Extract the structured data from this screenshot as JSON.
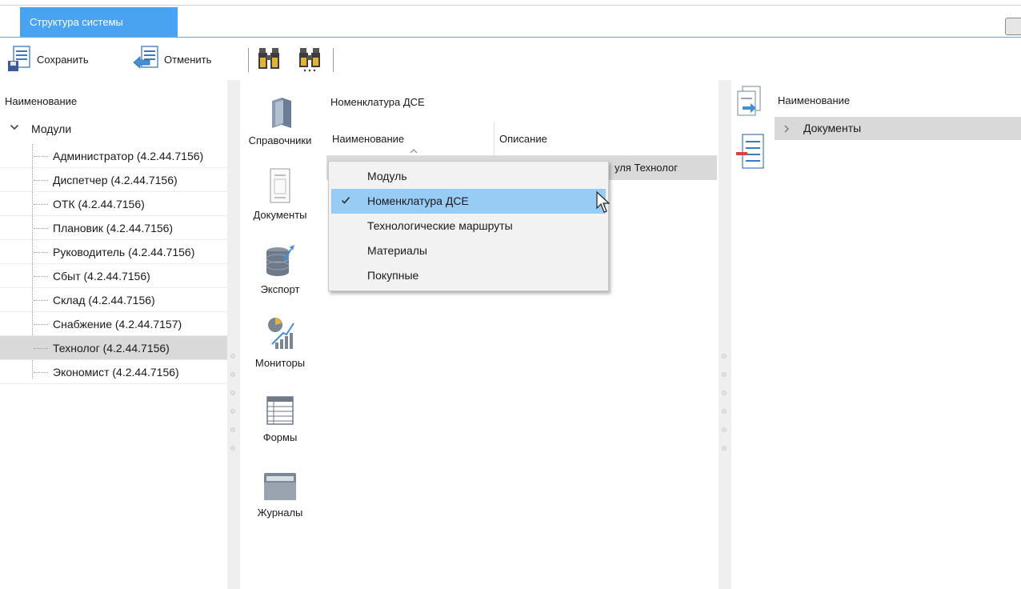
{
  "tabs": {
    "active": "Структура системы"
  },
  "toolbar": {
    "save_label": "Сохранить",
    "cancel_label": "Отменить"
  },
  "left": {
    "column_header": "Наименование",
    "root": "Модули",
    "items": [
      "Администратор (4.2.44.7156)",
      "Диспетчер (4.2.44.7156)",
      "ОТК (4.2.44.7156)",
      "Плановик (4.2.44.7156)",
      "Руководитель (4.2.44.7156)",
      "Сбыт (4.2.44.7156)",
      "Склад (4.2.44.7156)",
      "Снабжение (4.2.44.7157)",
      "Технолог (4.2.44.7156)",
      "Экономист (4.2.44.7156)"
    ],
    "selected_item": "Технолог (4.2.44.7156)"
  },
  "nav": {
    "directories": "Справочники",
    "documents": "Документы",
    "export": "Экспорт",
    "monitors": "Мониторы",
    "forms": "Формы",
    "journals": "Журналы"
  },
  "middle": {
    "title": "Номенклатура ДСЕ",
    "col_name": "Наименование",
    "col_desc": "Описание",
    "row_desc_fragment": "уля Технолог"
  },
  "dropdown": {
    "options": [
      "Модуль",
      "Номенклатура ДСЕ",
      "Технологические маршруты",
      "Материалы",
      "Покупные"
    ],
    "selected": "Номенклатура ДСЕ"
  },
  "right": {
    "column_header": "Наименование",
    "item": "Документы"
  },
  "colors": {
    "tab_active": "#4aa3f0",
    "selection": "#d9d9d9",
    "dropdown_highlight": "#99ccf5"
  }
}
